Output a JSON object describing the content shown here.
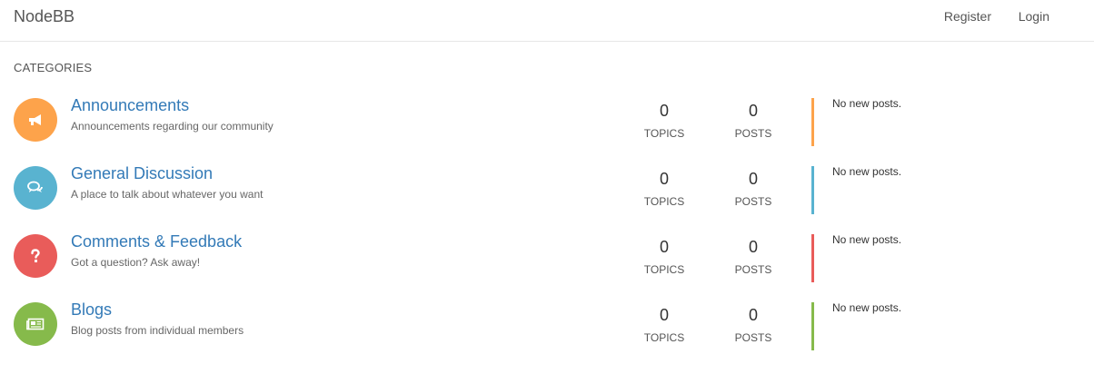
{
  "navbar": {
    "brand": "NodeBB",
    "register": "Register",
    "login": "Login"
  },
  "section_title": "CATEGORIES",
  "categories": [
    {
      "name": "Announcements",
      "description": "Announcements regarding our community",
      "icon": "bullhorn-icon",
      "color": "#fda34b",
      "topics": "0",
      "topics_label": "TOPICS",
      "posts": "0",
      "posts_label": "POSTS",
      "teaser": "No new posts."
    },
    {
      "name": "General Discussion",
      "description": "A place to talk about whatever you want",
      "icon": "comments-icon",
      "color": "#59b3d0",
      "topics": "0",
      "topics_label": "TOPICS",
      "posts": "0",
      "posts_label": "POSTS",
      "teaser": "No new posts."
    },
    {
      "name": "Comments & Feedback",
      "description": "Got a question? Ask away!",
      "icon": "question-icon",
      "color": "#e95c5a",
      "topics": "0",
      "topics_label": "TOPICS",
      "posts": "0",
      "posts_label": "POSTS",
      "teaser": "No new posts."
    },
    {
      "name": "Blogs",
      "description": "Blog posts from individual members",
      "icon": "newspaper-icon",
      "color": "#86ba4b",
      "topics": "0",
      "topics_label": "TOPICS",
      "posts": "0",
      "posts_label": "POSTS",
      "teaser": "No new posts."
    }
  ]
}
